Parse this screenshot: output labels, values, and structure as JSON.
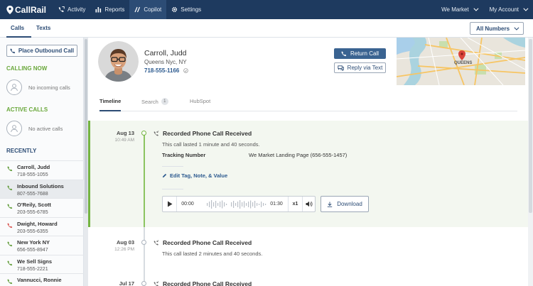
{
  "app": {
    "brand": "CallRail",
    "nav": [
      {
        "label": "Activity",
        "icon": "activity-icon"
      },
      {
        "label": "Reports",
        "icon": "reports-icon"
      },
      {
        "label": "Copilot",
        "icon": "copilot-icon"
      },
      {
        "label": "Settings",
        "icon": "gear-icon"
      }
    ],
    "account_menu": "We Market",
    "my_account": "My Account"
  },
  "subnav": {
    "tabs": [
      "Calls",
      "Texts"
    ],
    "active_tab": "Calls",
    "number_filter": "All Numbers"
  },
  "sidebar": {
    "outbound_button": "Place Outbound Call",
    "calling_now": {
      "heading": "CALLING NOW",
      "empty": "No incoming calls"
    },
    "active_calls": {
      "heading": "ACTIVE CALLS",
      "empty": "No active calls"
    },
    "recently": {
      "heading": "RECENTLY",
      "items": [
        {
          "name": "Carroll, Judd",
          "number": "718-555-1055",
          "status": "green"
        },
        {
          "name": "Inbound Solutions",
          "number": "807-555-7688",
          "status": "green",
          "selected": true
        },
        {
          "name": "O'Reily, Scott",
          "number": "203-555-6785",
          "status": "green"
        },
        {
          "name": "Dwight, Howard",
          "number": "203-555-6355",
          "status": "red"
        },
        {
          "name": "New York NY",
          "number": "656-555-8947",
          "status": "green"
        },
        {
          "name": "We Sell Signs",
          "number": "718-555-2221",
          "status": "green"
        },
        {
          "name": "Vannucci, Ronnie",
          "number": "",
          "status": "green"
        }
      ]
    }
  },
  "contact": {
    "name": "Carroll, Judd",
    "location": "Queens Nyc, NY",
    "phone": "718-555-1166",
    "return_call": "Return Call",
    "reply_text": "Reply via Text",
    "map_label": "QUEENS"
  },
  "tabs": {
    "items": [
      "Timeline",
      "Search",
      "HubSpot"
    ],
    "search_badge": "1",
    "active": "Timeline"
  },
  "timeline": [
    {
      "date": "Aug 13",
      "time": "10:49 AM",
      "title": "Recorded Phone Call Received",
      "desc": "This call lasted 1 minute and 40 seconds.",
      "tracking_label": "Tracking Number",
      "tracking_value": "We Market Landing Page (656-555-1457)",
      "edit_link": "Edit Tag, Note, & Value",
      "player": {
        "position": "00:00",
        "duration": "01:30",
        "speed": "x1"
      },
      "download": "Download",
      "active": true
    },
    {
      "date": "Aug 03",
      "time": "12:26 PM",
      "title": "Recorded Phone Call Received",
      "desc": "This call lasted 2 minutes and 40 seconds."
    },
    {
      "date": "Jul 17",
      "time": "",
      "title": "Recorded Phone Call Received",
      "desc": ""
    }
  ],
  "colors": {
    "nav_bg": "#1e3a5f",
    "accent_green": "#74b442",
    "primary_blue": "#3a6391",
    "missed_red": "#d9534f"
  }
}
